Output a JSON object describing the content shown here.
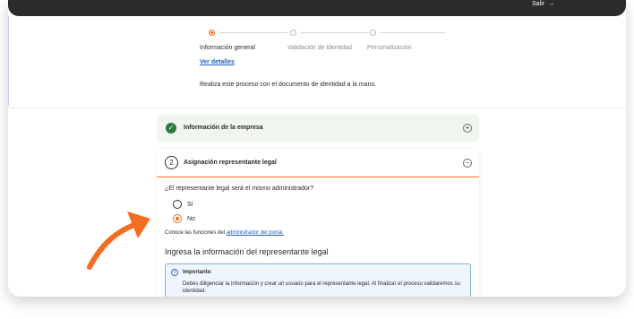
{
  "header": {
    "exit_label": "Salir",
    "exit_icon": "exit-arrow-icon"
  },
  "steps": {
    "items": [
      {
        "label": "Información general",
        "active": true
      },
      {
        "label": "Validación de identidad",
        "active": false
      },
      {
        "label": "Personalización",
        "active": false
      }
    ],
    "details_link": "Ver detalles"
  },
  "intro_text": "Realiza este proceso con el documento de identidad a la mano.",
  "company_card": {
    "title": "Información de la empresa",
    "status_icon": "check-icon",
    "toggle_icon": "plus-icon"
  },
  "legal_card": {
    "number": "2",
    "title": "Asignación representante legal",
    "toggle_icon": "minus-icon",
    "question": "¿El representante legal será el mismo administrador?",
    "options": [
      {
        "label": "Sí",
        "selected": false
      },
      {
        "label": "No",
        "selected": true
      }
    ],
    "functions_prefix": "Conoce las funciones del",
    "functions_link": "administrador del portal.",
    "section_title": "Ingresa la información del representante legal",
    "important_title": "Importante:",
    "important_text": "Debes diligenciar la información y crear un usuario para el representante legal. Al finalizar el proceso validaremos su identidad."
  },
  "colors": {
    "accent": "#f26d21",
    "success": "#2f7a3a",
    "link": "#1f5fbf",
    "topbar": "#2b2b2b"
  }
}
